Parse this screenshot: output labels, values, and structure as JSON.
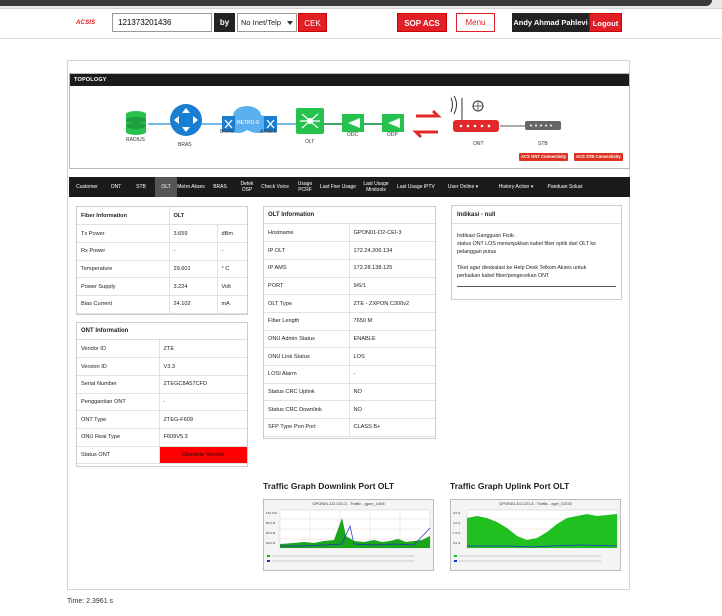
{
  "header": {
    "logo": "ACSIS",
    "search_value": "121373201436",
    "by_label": "by",
    "select_value": "No Inet/Telp",
    "cek_label": "CEK",
    "sop_label": "SOP ACS",
    "menu_label": "Menu",
    "user_name": "Andy Ahmad Pahlevi",
    "logout_label": "Logout"
  },
  "topology": {
    "title": "TOPOLOGY",
    "devices": {
      "radius": "RADIUS",
      "bras": "BRAS",
      "metro_e": "METRO-E",
      "bras2": "BRAS",
      "akses": "AKSES",
      "olt": "OLT",
      "odc": "ODC",
      "odp": "ODP",
      "ont": "ONT",
      "stb": "STB"
    },
    "badges": [
      "ACS ONT Connectivity",
      "ACS STB Connectivity"
    ]
  },
  "nav": [
    {
      "label": "Customer"
    },
    {
      "label": "ONT"
    },
    {
      "label": "STB"
    },
    {
      "label": "OLT"
    },
    {
      "label": "Metro Akses"
    },
    {
      "label": "BRAS"
    },
    {
      "label": "Detek OSP"
    },
    {
      "label": "Check Voice"
    },
    {
      "label": "Usage PCRF"
    },
    {
      "label": "Last Five Usage"
    },
    {
      "label": "Last Usage Minitools"
    },
    {
      "label": "Last Usage IPTV"
    },
    {
      "label": "User Online ▾"
    },
    {
      "label": "History Action ▾"
    },
    {
      "label": "Panduan Solusi"
    }
  ],
  "fiber": {
    "h1": "Fiber Information",
    "h2": "OLT",
    "rows": [
      [
        "Tx Power",
        "3.659",
        "dBm"
      ],
      [
        "Rx Power",
        "-",
        "-"
      ],
      [
        "Temperature",
        "29.601",
        "° C"
      ],
      [
        "Power Supply",
        "3.224",
        "Volt"
      ],
      [
        "Bias Current",
        "24.102",
        "mA"
      ]
    ]
  },
  "ont": {
    "title": "ONT Information",
    "rows": [
      [
        "Vendor ID",
        "ZTE"
      ],
      [
        "Version ID",
        "V3.3"
      ],
      [
        "Serial Number",
        "ZTEGC8A57CFD"
      ],
      [
        "Penggantian ONT",
        "-"
      ],
      [
        "ONT Type",
        "ZTEG-F609"
      ],
      [
        "ONU Real Type",
        "F609V5.3"
      ],
      [
        "Status ONT",
        "Obsolete Version"
      ]
    ]
  },
  "olt": {
    "title": "OLT Information",
    "rows": [
      [
        "Hostname",
        "GPON01-D2-CEI-3"
      ],
      [
        "IP OLT",
        "172.24.206.134"
      ],
      [
        "IP AMS",
        "172.28.138.125"
      ],
      [
        "PORT",
        "9/6/1"
      ],
      [
        "OLT Type",
        "ZTE - ZXPON C300v2"
      ],
      [
        "Fiber Length",
        "7650 M"
      ],
      [
        "ONU Admin Status",
        "ENABLE"
      ],
      [
        "ONU Link Status",
        "LOS"
      ],
      [
        "LOSI Alarm",
        "-"
      ],
      [
        "Status CRC Uplink",
        "NO"
      ],
      [
        "Status CRC Downlink",
        "NO"
      ],
      [
        "SFP Type Pon Port",
        "CLASS B+"
      ]
    ]
  },
  "alert": {
    "title": "Indikasi - null",
    "lines": [
      "Indikasi Gangguan Fisik:",
      "status ONT LOS menunjukkan kabel fiber optik dari OLT ke",
      "pelanggan putus",
      "",
      "Tiket agar dieskalasi ke Help Desk Telkom Akses untuk",
      "perbaikan kabel fiber/pengecekan ONT"
    ]
  },
  "graphs": {
    "down_title": "Traffic Graph Downlink Port OLT",
    "up_title": "Traffic Graph Uplink Port OLT",
    "down_caption": "GPON01-D2-CEI-3 - Traffic - gpon_1/6/6",
    "up_caption": "GPON01-D2-CEI-3 - Traffic - xgei_1/20/2"
  },
  "footer": {
    "time": "Time: 2.3961 s"
  },
  "colors": {
    "accent": "#e01f27",
    "dark": "#1b1b1b",
    "status_red": "#ff0000",
    "device_green": "#26c24e",
    "device_blue": "#1a7ed0"
  }
}
